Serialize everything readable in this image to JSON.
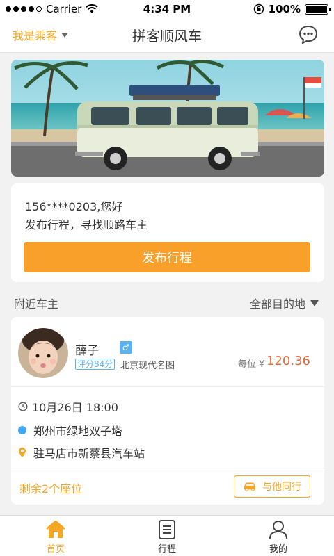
{
  "status_bar": {
    "carrier": "Carrier",
    "time": "4:34 PM",
    "battery": "100%",
    "battery_level": 1.0
  },
  "nav": {
    "role_label": "我是乘客",
    "title": "拼客顺风车"
  },
  "welcome": {
    "greeting": "156****0203,您好",
    "prompt": "发布行程，寻找顺路车主",
    "publish_button": "发布行程"
  },
  "section": {
    "title": "附近车主",
    "filter": "全部目的地"
  },
  "driver": {
    "name": "薛子",
    "gender": "♂",
    "rating": "评分84分",
    "car_model": "北京现代名图",
    "price_label": "每位 ¥",
    "price_value": "120.36",
    "time": "10月26日  18:00",
    "from": "郑州市绿地双子塔",
    "to": "驻马店市新蔡县汽车站",
    "seats_left": "剩余2个座位",
    "join_button": "与他同行"
  },
  "tabs": [
    {
      "label": "首页",
      "icon": "home-icon",
      "active": true
    },
    {
      "label": "行程",
      "icon": "list-icon",
      "active": false
    },
    {
      "label": "我的",
      "icon": "user-icon",
      "active": false
    }
  ],
  "colors": {
    "accent": "#f9a02b",
    "price": "#e66b3c",
    "blue": "#42a8f0"
  }
}
